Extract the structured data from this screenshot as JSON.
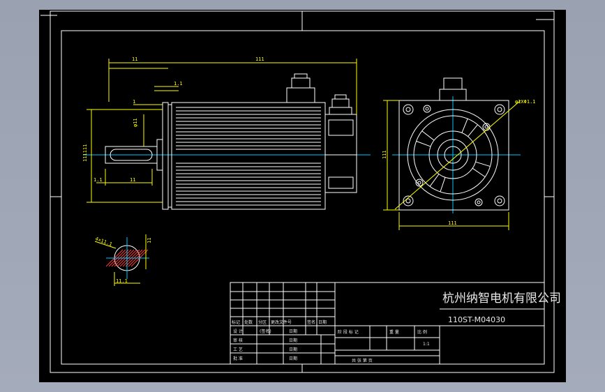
{
  "title_block": {
    "company": "杭州纳智电机有限公司",
    "model": "110ST-M04030",
    "revision_headers": [
      "标记",
      "处数",
      "分区",
      "更改文件号",
      "签名",
      "日期"
    ],
    "role_rows": [
      {
        "role": "设 计",
        "sign": "(签名)",
        "date_label": "日期"
      },
      {
        "role": "审 核",
        "sign": "",
        "date_label": "日期"
      },
      {
        "role": "工 艺",
        "sign": "",
        "date_label": "日期"
      },
      {
        "role": "批 准",
        "sign": "",
        "date_label": "日期"
      }
    ],
    "stage_headers": [
      "阶 段 标 记",
      "重 量",
      "比 例"
    ],
    "scale": "1:1",
    "sheet_info": "共   张   第   页"
  },
  "dimensions": {
    "top_overall": "111",
    "top_left": "11",
    "shaft_step": "1.1",
    "shaft_small": "1",
    "shaft_dia": "φ11",
    "flange_left": "111111",
    "key_len": "11",
    "key_off": "1.1",
    "side_height": "111",
    "side_width": "111",
    "bolt_circle": "φ1XΦ1.1",
    "section_label": "4×11.1",
    "section_bottom": "11.1",
    "section_side": "11"
  },
  "colors": {
    "sheet": "#000000",
    "frame": "#ffffff",
    "dimension": "#ffff00",
    "centerline": "#00c8ff",
    "hatch": "#ff4040"
  }
}
